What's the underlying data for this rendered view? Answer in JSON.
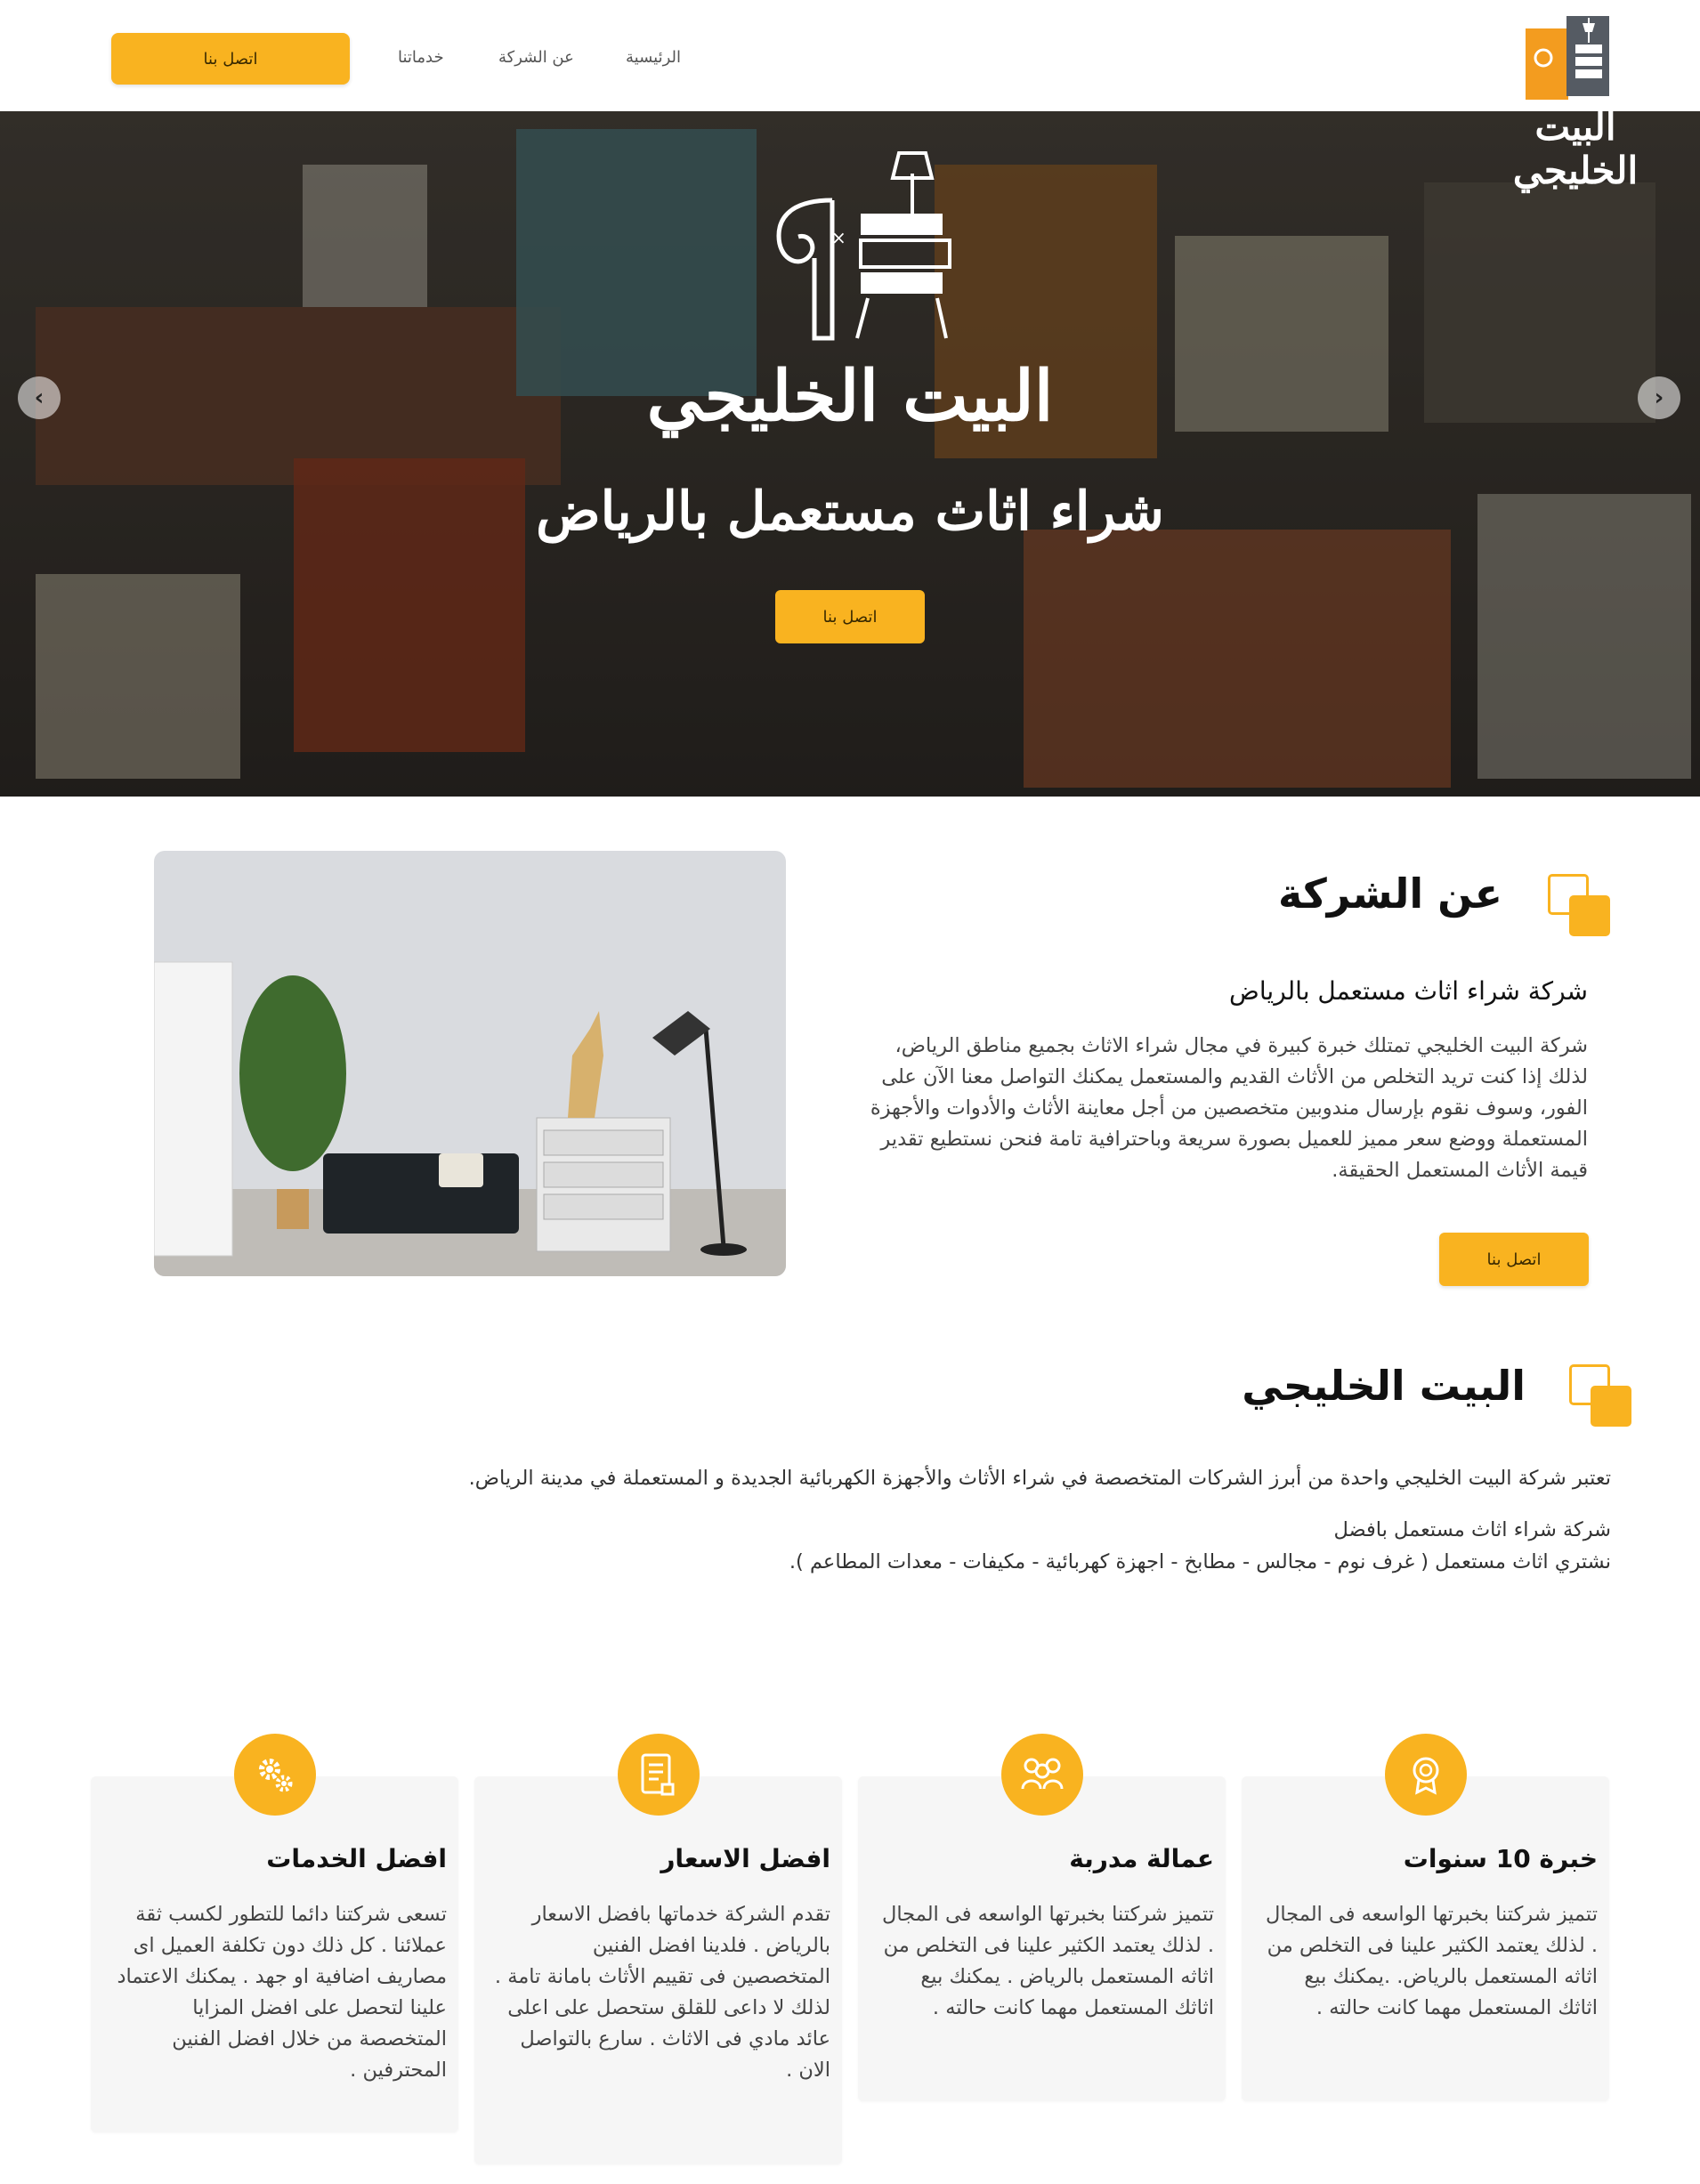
{
  "colors": {
    "accent": "#f9b320",
    "text_dark": "#111111",
    "card_bg": "#f6f6f6"
  },
  "header": {
    "cta_label": "اتصل بنا",
    "nav": [
      {
        "label": "الرئيسية"
      },
      {
        "label": "عن الشركة"
      },
      {
        "label": "خدماتنا"
      }
    ],
    "logo_text": "البيت الخليجي"
  },
  "hero": {
    "brand": "البيت الخليجي",
    "headline": "شراء اثاث مستعمل بالرياض",
    "cta_label": "اتصل بنا",
    "prev_icon": "chevron-left-icon",
    "next_icon": "chevron-right-icon"
  },
  "about": {
    "title": "عن الشركة",
    "subtitle": "شركة شراء اثاث مستعمل بالرياض",
    "body": "شركة البيت الخليجي تمتلك خبرة كبيرة في مجال شراء الاثاث بجميع مناطق الرياض، لذلك إذا كنت تريد التخلص من الأثاث القديم والمستعمل يمكنك التواصل معنا الآن على الفور، وسوف نقوم بإرسال مندوبين متخصصين من أجل معاينة الأثاث والأدوات والأجهزة المستعملة ووضع سعر مميز للعميل بصورة سريعة وباحترافية تامة فنحن نستطيع تقدير قيمة الأثاث المستعمل الحقيقة.",
    "cta_label": "اتصل بنا"
  },
  "brand_section": {
    "title": "البيت الخليجي",
    "intro": "تعتبر شركة البيت الخليجي واحدة من أبرز الشركات المتخصصة في شراء الأثاث والأجهزة الكهربائية الجديدة و المستعملة في مدينة الرياض.",
    "line1": "شركة شراء اثاث مستعمل بافضل",
    "line2": "نشتري اثاث مستعمل ( غرف نوم - مجالس - مطابخ - اجهزة كهربائية - مكيفات - معدات المطاعم )."
  },
  "features": [
    {
      "icon": "award-badge-icon",
      "title": "خبرة 10 سنوات",
      "body": "تتميز شركتنا بخبرتها الواسعه فى المجال . لذلك يعتمد الكثير علينا فى التخلص من اثاثه المستعمل بالرياض. .يمكنك بيع اثاثك المستعمل مهما كانت حالته ."
    },
    {
      "icon": "team-icon",
      "title": "عمالة مدربة",
      "body": "تتميز شركتنا بخبرتها الواسعه فى المجال . لذلك يعتمد الكثير علينا فى التخلص من اثاثه المستعمل بالرياض . يمكنك بيع اثاثك المستعمل مهما كانت حالته ."
    },
    {
      "icon": "price-document-icon",
      "title": "افضل الاسعار",
      "body": "تقدم الشركة خدماتها بافضل الاسعار بالرياض . فلدينا افضل الفنين المتخصصين فى تقييم الأثاث بامانة تامة . لذلك لا داعى للقلق ستحصل على اعلى عائد مادي فى الاثاث . سارع بالتواصل الان ."
    },
    {
      "icon": "gears-icon",
      "title": "افضل الخدمات",
      "body": "تسعى شركتنا دائما للتطور لكسب ثقة عملائنا . كل ذلك دون تكلفة العميل اى مصاريف اضافية او جهد . يمكنك الاعتماد علينا لتحصل على افضل المزايا المتخصصة من خلال افضل الفنين المحترفين ."
    }
  ]
}
